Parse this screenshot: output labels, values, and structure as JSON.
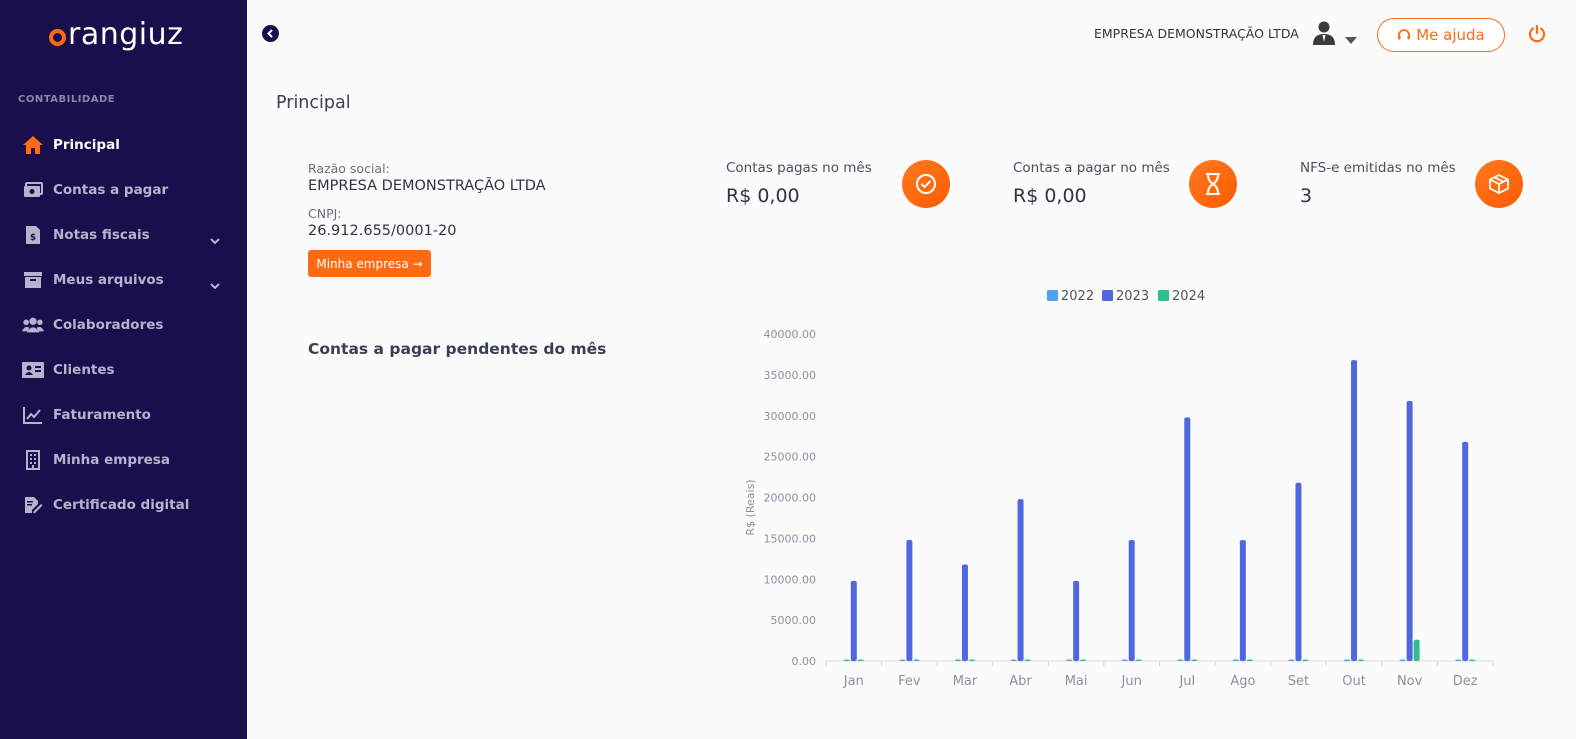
{
  "sidebar": {
    "logo_text": "rangiuz",
    "section_label": "CONTABILIDADE",
    "items": [
      {
        "label": "Principal",
        "icon": "home-icon",
        "active": true
      },
      {
        "label": "Contas a pagar",
        "icon": "money-icon"
      },
      {
        "label": "Notas fiscais",
        "icon": "invoice-icon",
        "expandable": true
      },
      {
        "label": "Meus arquivos",
        "icon": "archive-icon",
        "expandable": true
      },
      {
        "label": "Colaboradores",
        "icon": "users-icon"
      },
      {
        "label": "Clientes",
        "icon": "id-card-icon"
      },
      {
        "label": "Faturamento",
        "icon": "chart-line-icon"
      },
      {
        "label": "Minha empresa",
        "icon": "building-icon"
      },
      {
        "label": "Certificado digital",
        "icon": "certificate-icon"
      }
    ]
  },
  "topbar": {
    "company_name": "EMPRESA DEMONSTRAÇÃO LTDA",
    "help_label": "Me ajuda"
  },
  "page_title": "Principal",
  "company": {
    "razao_label": "Razão social:",
    "razao_value": "EMPRESA DEMONSTRAÇÃO LTDA",
    "cnpj_label": "CNPJ:",
    "cnpj_value": "26.912.655/0001-20",
    "button_label": "Minha empresa →"
  },
  "stats": [
    {
      "label": "Contas pagas no mês",
      "value": "R$ 0,00",
      "icon": "check-circle-icon"
    },
    {
      "label": "Contas a pagar no mês",
      "value": "R$ 0,00",
      "icon": "hourglass-icon"
    },
    {
      "label": "NFS-e emitidas no mês",
      "value": "3",
      "icon": "box-icon"
    }
  ],
  "pending_title": "Contas a pagar pendentes do mês",
  "colors": {
    "sidebar_bg": "#1a0f4d",
    "accent": "#ff6a13",
    "series_2022": "#4da3ef",
    "series_2023": "#4f68e0",
    "series_2024": "#2ec08a"
  },
  "chart_data": {
    "type": "bar",
    "categories": [
      "Jan",
      "Fev",
      "Mar",
      "Abr",
      "Mai",
      "Jun",
      "Jul",
      "Ago",
      "Set",
      "Out",
      "Nov",
      "Dez"
    ],
    "series": [
      {
        "name": "2022",
        "color": "#4da3ef",
        "values": [
          0,
          0,
          0,
          0,
          0,
          0,
          0,
          0,
          0,
          0,
          0,
          0
        ]
      },
      {
        "name": "2023",
        "color": "#4f68e0",
        "values": [
          9800,
          14800,
          11800,
          19800,
          9800,
          14800,
          29800,
          14800,
          21800,
          36800,
          31800,
          26800
        ]
      },
      {
        "name": "2024",
        "color": "#2ec08a",
        "values": [
          0,
          0,
          0,
          0,
          0,
          0,
          0,
          0,
          0,
          0,
          2600,
          0
        ]
      }
    ],
    "ylabel": "R$ (Reais)",
    "ylim": [
      0,
      40000
    ],
    "yticks": [
      "0.00",
      "5000.00",
      "10000.00",
      "15000.00",
      "20000.00",
      "25000.00",
      "30000.00",
      "35000.00",
      "40000.00"
    ],
    "legend": "top-center",
    "grid": false
  }
}
